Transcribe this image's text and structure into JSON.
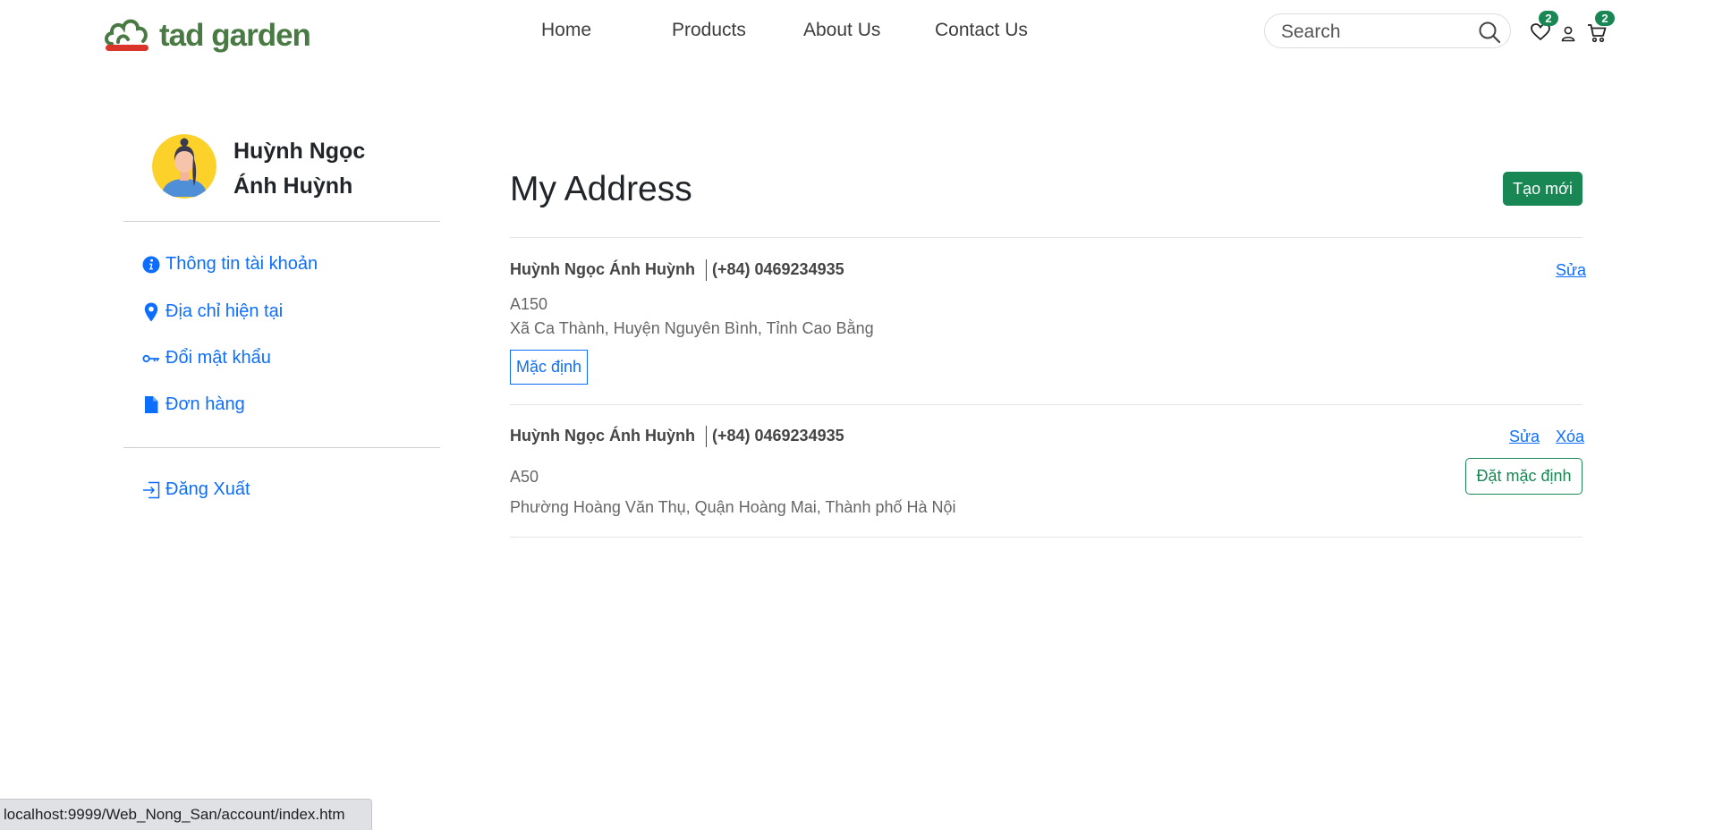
{
  "header": {
    "brand": "tad garden",
    "nav": [
      {
        "label": "Home"
      },
      {
        "label": "Products"
      },
      {
        "label": "About Us"
      },
      {
        "label": "Contact Us"
      }
    ],
    "search_placeholder": "Search",
    "wishlist_count": "2",
    "cart_count": "2",
    "icons": [
      "search-icon",
      "heart-icon",
      "user-icon",
      "cart-icon"
    ]
  },
  "sidebar": {
    "user_name_line1": "Huỳnh Ngọc",
    "user_name_line2": "Ánh Huỳnh",
    "items": [
      {
        "label": "Thông tin tài khoản",
        "icon": "info-icon"
      },
      {
        "label": "Địa chỉ hiện tại",
        "icon": "map-pin-icon"
      },
      {
        "label": "Đổi mật khẩu",
        "icon": "key-icon"
      },
      {
        "label": "Đơn hàng",
        "icon": "document-icon"
      }
    ],
    "logout_label": "Đăng Xuất"
  },
  "main": {
    "title": "My Address",
    "create_button": "Tạo mới",
    "addresses": [
      {
        "name": "Huỳnh Ngọc Ánh Huỳnh",
        "phone": "(+84) 0469234935",
        "line1": "A150",
        "line2": "Xã Ca Thành, Huyện Nguyên Bình, Tỉnh Cao Bằng",
        "default_tag": "Mặc định",
        "edit_label": "Sửa"
      },
      {
        "name": "Huỳnh Ngọc Ánh Huỳnh",
        "phone": "(+84) 0469234935",
        "line1": "A50",
        "line2": "Phường Hoàng Văn Thụ, Quận Hoàng Mai, Thành phố Hà Nội",
        "edit_label": "Sửa",
        "delete_label": "Xóa",
        "set_default_label": "Đặt mặc định"
      }
    ]
  },
  "status_bar": {
    "url": "localhost:9999/Web_Nong_San/account/index.htm"
  },
  "colors": {
    "brand_green": "#4a7a43",
    "primary_blue": "#0d6efd",
    "success_green": "#198754",
    "logo_red": "#d9352b"
  }
}
